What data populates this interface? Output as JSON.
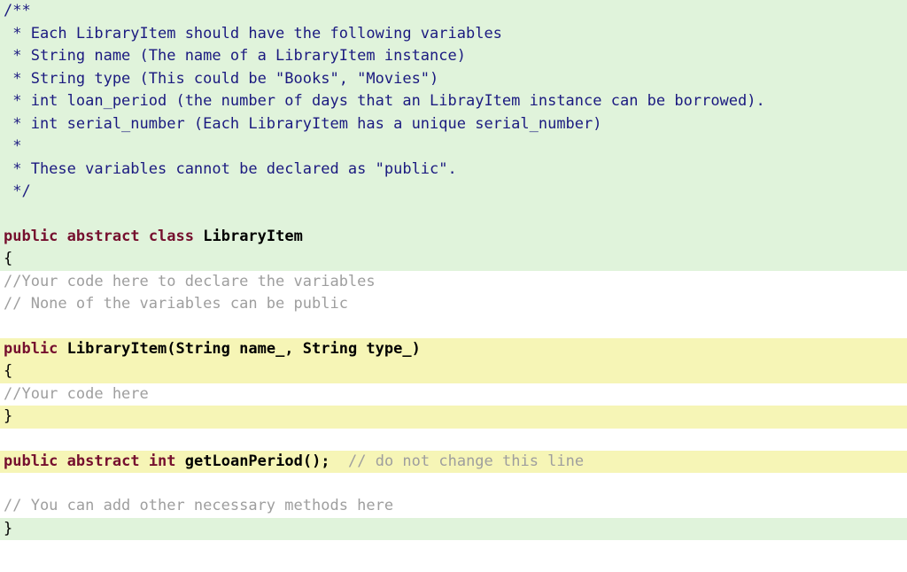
{
  "javadoc": {
    "l1": "/**",
    "l2": " * Each LibraryItem should have the following variables",
    "l3": " * String name (The name of a LibraryItem instance)",
    "l4": " * String type (This could be \"Books\", \"Movies\")",
    "l5": " * int loan_period (the number of days that an LibrayItem instance can be borrowed).",
    "l6": " * int serial_number (Each LibraryItem has a unique serial_number)",
    "l7": " *",
    "l8": " * These variables cannot be declared as \"public\".",
    "l9": " */"
  },
  "decl": {
    "public": "public",
    "abstract": "abstract",
    "class_kw": "class",
    "class_name": "LibraryItem",
    "open_brace": "{",
    "close_brace": "}"
  },
  "body": {
    "c1": "//Your code here to declare the variables",
    "c2": "// None of the variables can be public",
    "ctor": {
      "public": "public",
      "name_sig": "LibraryItem(String name_, String type_)",
      "open": "{",
      "inner_comment": "//Your code here",
      "close": "}"
    },
    "abs_method": {
      "public": "public",
      "abstract": "abstract",
      "int_kw": "int",
      "name": "getLoanPeriod();  ",
      "trailing_comment": "// do not change this line"
    },
    "c3": "// You can add other necessary methods here"
  }
}
